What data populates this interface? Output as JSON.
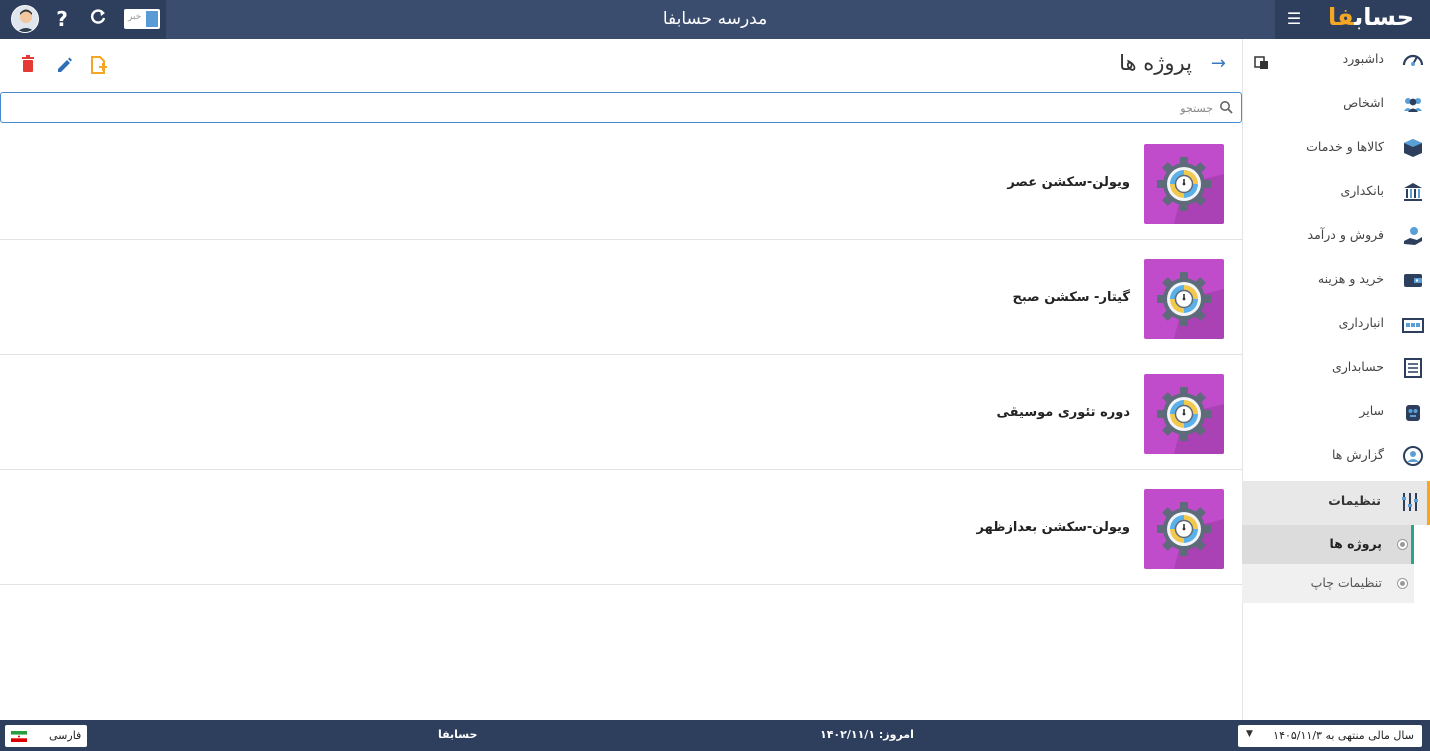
{
  "app": {
    "logo_text": "حساب",
    "logo_accent": "فا",
    "company_title": "مدرسه حسابفا",
    "news_toggle_label": "خبر"
  },
  "colors": {
    "header": "#3b4d6e",
    "header_dark": "#2e3f5e",
    "accent_orange": "#f5a623",
    "thumb_purple": "#c04bcb",
    "active_green": "#2aa58c"
  },
  "sidebar": {
    "items": [
      {
        "label": "داشبورد",
        "icon": "dashboard-icon"
      },
      {
        "label": "اشخاص",
        "icon": "people-icon"
      },
      {
        "label": "کالاها و خدمات",
        "icon": "box-icon"
      },
      {
        "label": "بانکداری",
        "icon": "bank-icon"
      },
      {
        "label": "فروش و درآمد",
        "icon": "sales-icon"
      },
      {
        "label": "خرید و هزینه",
        "icon": "wallet-icon"
      },
      {
        "label": "انبارداری",
        "icon": "warehouse-icon"
      },
      {
        "label": "حسابداری",
        "icon": "ledger-icon"
      },
      {
        "label": "سایر",
        "icon": "other-icon"
      },
      {
        "label": "گزارش ها",
        "icon": "report-icon"
      },
      {
        "label": "تنظیمات",
        "icon": "settings-sliders-icon"
      }
    ],
    "sub_items": [
      {
        "label": "پروژه ها"
      },
      {
        "label": "تنظیمات چاپ"
      }
    ]
  },
  "page": {
    "title": "پروژه ها"
  },
  "search": {
    "placeholder": "جستجو"
  },
  "projects": [
    {
      "name": "ویولن-سکشن عصر"
    },
    {
      "name": "گیتار- سکشن صبح"
    },
    {
      "name": "دوره تئوری موسیقی"
    },
    {
      "name": "ویولن-سکشن بعدازظهر"
    }
  ],
  "statusbar": {
    "fiscal_year": "سال مالی منتهی به ۱۴۰۵/۱۱/۳",
    "today": "امروز: ۱۴۰۲/۱۱/۱",
    "brand": "حسابفا",
    "language": "فارسی"
  }
}
